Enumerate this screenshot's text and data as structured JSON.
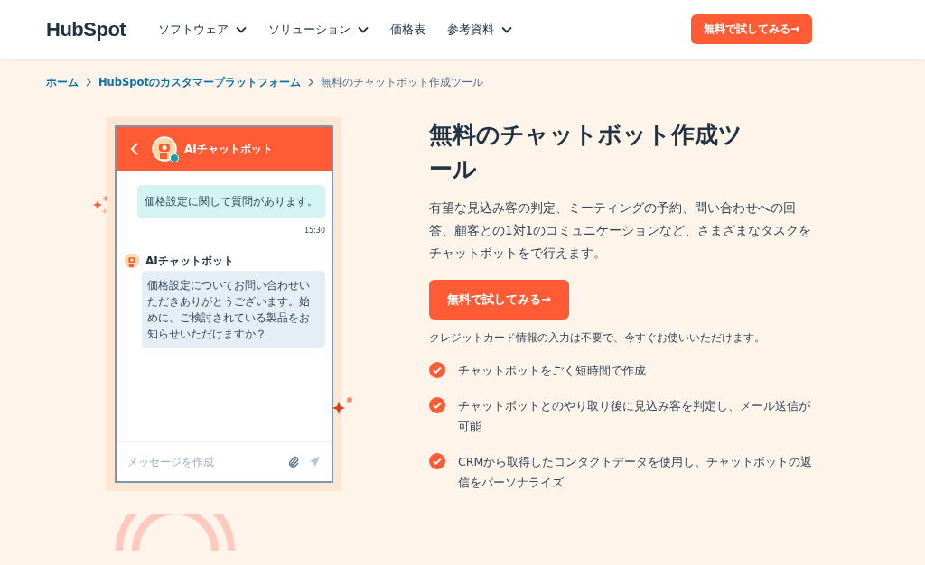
{
  "header": {
    "logo": "HubSpot",
    "nav": [
      {
        "label": "ソフトウェア",
        "dropdown": true
      },
      {
        "label": "ソリューション",
        "dropdown": true
      },
      {
        "label": "価格表",
        "dropdown": false
      },
      {
        "label": "参考資料",
        "dropdown": true
      }
    ],
    "cta": "無料で試してみる→"
  },
  "breadcrumb": [
    {
      "label": "ホーム",
      "link": true
    },
    {
      "label": "HubSpotのカスタマープラットフォーム",
      "link": true
    },
    {
      "label": "無料のチャットボット作成ツール",
      "link": false
    }
  ],
  "chat": {
    "title": "AIチャットボット",
    "online": true,
    "messages": [
      {
        "kind": "user",
        "text": "価格設定に関して質問があります。",
        "time": "15:30"
      },
      {
        "kind": "bot",
        "sender": "AIチャットボット",
        "text": "価格設定についてお問い合わせいただきありがとうございます。始めに、ご検討されている製品をお知らせいただけますか？"
      }
    ],
    "placeholder": "メッセージを作成"
  },
  "hero": {
    "title": "無料のチャットボット作成ツール",
    "description": "有望な見込み客の判定、ミーティングの予約、問い合わせへの回答、顧客との1対1のコミュニケーションなど、さまざまなタスクをチャットボットをで行えます。",
    "cta": "無料で試してみる→",
    "note": "クレジットカード情報の入力は不要で、今すぐお使いいただけます。",
    "features": [
      {
        "text": "チャットボットをごく短時間で作成"
      },
      {
        "text": "チャットボットとのやり取り後に見込み客を判定し、メール送信が可能"
      },
      {
        "text": "CRMから取得したコンタクトデータを使用し、チャットボットの返信をパーソナライズ"
      }
    ]
  }
}
